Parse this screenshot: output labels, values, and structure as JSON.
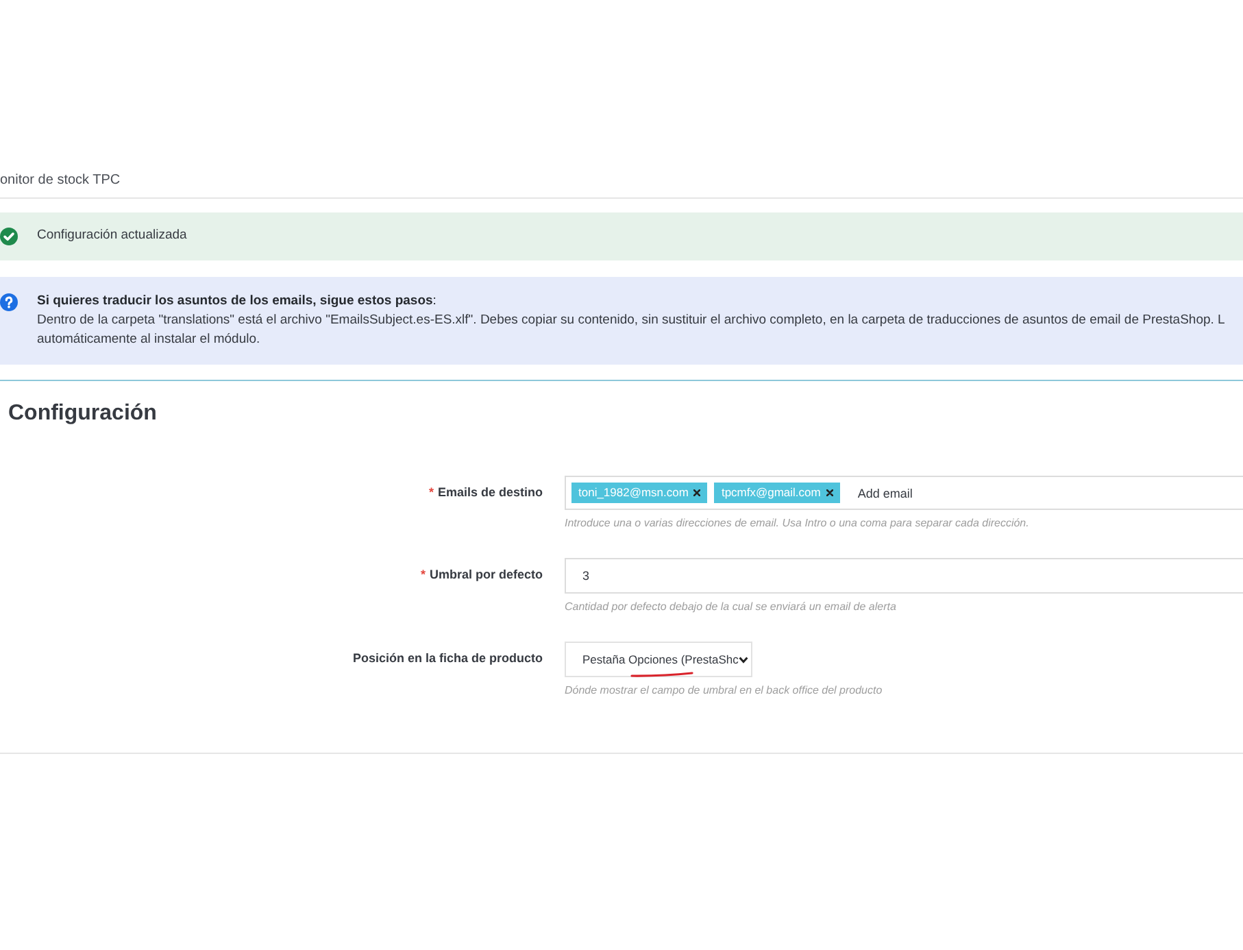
{
  "header": {
    "title": "onitor de stock TPC"
  },
  "alerts": [
    {
      "kind": "success",
      "title": "Configuración actualizada"
    },
    {
      "kind": "info",
      "title": "**Si quieres traducir los asuntos de los emails, sigue estos pasos**:",
      "lines": [
        "Dentro de la carpeta \"translations\" está el archivo \"EmailsSubject.es-ES.xlf\". Debes copiar su contenido, sin sustituir el archivo completo, en la carpeta de traducciones de asuntos de email de PrestaShop. L",
        "automáticamente al instalar el módulo."
      ]
    }
  ],
  "panel": {
    "title": "Configuración",
    "fields": [
      {
        "kind": "tags",
        "required_mark": "*",
        "label": "Emails de destino",
        "tags": [
          "toni_1982@msn.com",
          "tpcmfx@gmail.com"
        ],
        "placeholder": "Add email",
        "help": "Introduce una o varias direcciones de email. Usa Intro o una coma para separar cada dirección."
      },
      {
        "kind": "text",
        "required_mark": "*",
        "label": "Umbral por defecto",
        "value": "3",
        "help": "Cantidad por defecto debajo de la cual se enviará un email de alerta"
      },
      {
        "kind": "select",
        "label": "Posición en la ficha de producto",
        "value": "Pestaña Opciones (PrestaShc",
        "annotated": true,
        "help": "Dónde mostrar el campo de umbral en el back office del producto"
      }
    ]
  }
}
